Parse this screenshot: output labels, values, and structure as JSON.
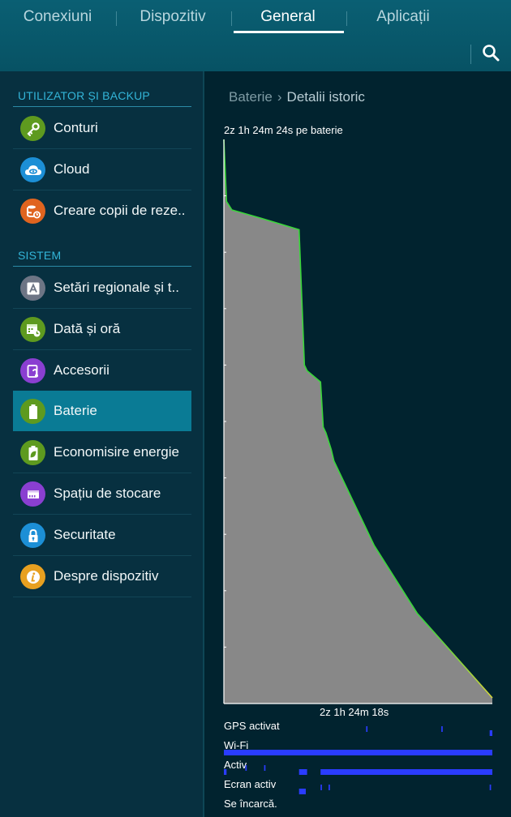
{
  "tabs": [
    {
      "label": "Conexiuni"
    },
    {
      "label": "Dispozitiv"
    },
    {
      "label": "General"
    },
    {
      "label": "Aplicații"
    }
  ],
  "active_tab": "General",
  "sidebar": {
    "sections": [
      {
        "header": "UTILIZATOR ȘI BACKUP"
      },
      {
        "header": "SISTEM"
      }
    ],
    "items": [
      {
        "label": "Conturi",
        "icon": "key-icon",
        "color": "#5e9a1f"
      },
      {
        "label": "Cloud",
        "icon": "cloud-icon",
        "color": "#1c8fd6"
      },
      {
        "label": "Creare copii de reze..",
        "icon": "backup-icon",
        "color": "#e0641f"
      },
      {
        "label": "Setări regionale și t..",
        "icon": "language-icon",
        "color": "#6d7585"
      },
      {
        "label": "Dată și oră",
        "icon": "calendar-clock-icon",
        "color": "#5e9a1f"
      },
      {
        "label": "Accesorii",
        "icon": "accessories-icon",
        "color": "#8a3fd1"
      },
      {
        "label": "Baterie",
        "icon": "battery-icon",
        "color": "#5e9a1f"
      },
      {
        "label": "Economisire energie",
        "icon": "power-saving-icon",
        "color": "#5e9a1f"
      },
      {
        "label": "Spațiu de stocare",
        "icon": "storage-icon",
        "color": "#8a3fd1"
      },
      {
        "label": "Securitate",
        "icon": "lock-icon",
        "color": "#1c8fd6"
      },
      {
        "label": "Despre dispozitiv",
        "icon": "info-icon",
        "color": "#e8a020"
      }
    ],
    "active_item": "Baterie"
  },
  "breadcrumb": {
    "root": "Baterie",
    "current": "Detalii istoric"
  },
  "chart_data": {
    "type": "area",
    "title": "2z 1h 24m 24s pe baterie",
    "xlabel": "2z 1h 24m 18s",
    "ylabel": "",
    "ylim": [
      0,
      100
    ],
    "x_unit": "fraction of elapsed time",
    "series": [
      {
        "x": [
          0,
          0.01,
          0.03,
          0.14,
          0.28,
          0.3,
          0.31,
          0.36,
          0.37,
          0.38,
          0.4,
          0.41,
          0.56,
          0.72,
          1.0
        ],
        "values": [
          100,
          89,
          87.5,
          86,
          84,
          60,
          59,
          57,
          49,
          48,
          45,
          43,
          28,
          16,
          1
        ]
      }
    ],
    "grid": false,
    "colors": {
      "fill": "#888888",
      "line": "#39d639",
      "line_end": "#d6d639"
    }
  },
  "status_rows": [
    {
      "label": "GPS activat",
      "segments": [
        [
          0.53,
          0.535
        ],
        [
          0.81,
          0.815
        ],
        [
          0.99,
          1.0
        ]
      ],
      "color": "#2a3cff"
    },
    {
      "label": "Wi-Fi",
      "segments": [
        [
          0.0,
          1.0
        ]
      ],
      "color": "#2a3cff"
    },
    {
      "label": "Activ",
      "segments": [
        [
          0.0,
          0.01
        ],
        [
          0.08,
          0.085
        ],
        [
          0.15,
          0.155
        ],
        [
          0.28,
          0.31
        ],
        [
          0.36,
          1.0
        ]
      ],
      "color": "#2a3cff"
    },
    {
      "label": "Ecran activ",
      "segments": [
        [
          0.28,
          0.305
        ],
        [
          0.36,
          0.365
        ],
        [
          0.39,
          0.395
        ],
        [
          0.99,
          0.995
        ]
      ],
      "color": "#2a3cff"
    },
    {
      "label": "Se încarcă.",
      "segments": [],
      "color": "#2a3cff"
    }
  ]
}
